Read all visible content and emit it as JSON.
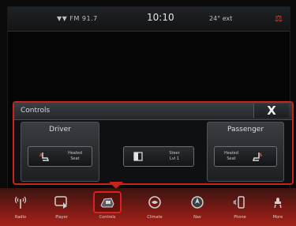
{
  "status_bar": {
    "left_text": "▼▼ FM 91.7",
    "clock": "10:10",
    "right_text": "24° ext"
  },
  "controls": {
    "title": "Controls",
    "close_label": "X",
    "driver": {
      "header": "Driver",
      "button_label_1": "Heated",
      "button_label_2": "Seat"
    },
    "center": {
      "button_label_1": "Steer",
      "button_label_2": "Lvl 1"
    },
    "passenger": {
      "header": "Passenger",
      "button_label_1": "Heated",
      "button_label_2": "Seat"
    }
  },
  "nav": {
    "items": [
      {
        "label": "Radio",
        "icon": "radio-icon"
      },
      {
        "label": "Player",
        "icon": "player-icon"
      },
      {
        "label": "Controls",
        "icon": "controls-icon",
        "active": true
      },
      {
        "label": "Climate",
        "icon": "climate-icon"
      },
      {
        "label": "Nav",
        "icon": "nav-icon"
      },
      {
        "label": "Phone",
        "icon": "phone-icon"
      },
      {
        "label": "More",
        "icon": "more-icon"
      }
    ]
  },
  "colors": {
    "accent": "#c8231d",
    "nav_gradient_top": "#3a1412",
    "nav_gradient_bottom": "#a4221a"
  }
}
